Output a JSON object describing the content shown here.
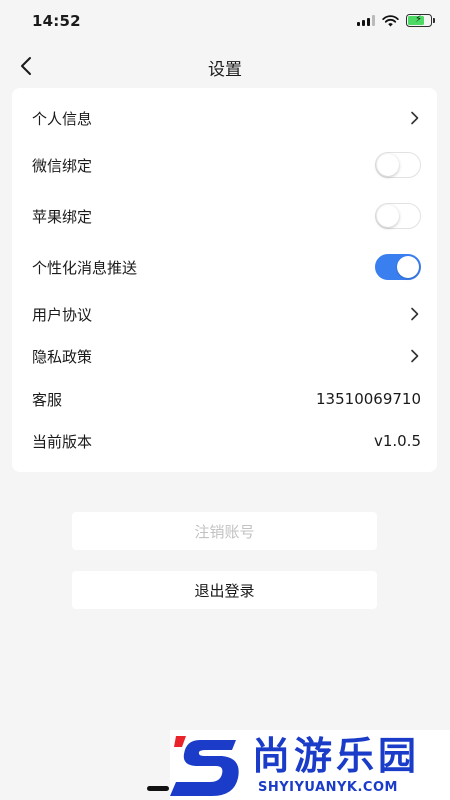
{
  "status_bar": {
    "time": "14:52",
    "battery_level": 0.75,
    "icons": [
      "signal-icon",
      "wifi-icon",
      "battery-charging-icon"
    ]
  },
  "nav": {
    "title": "设置",
    "back_icon": "chevron-left-icon"
  },
  "settings": {
    "personal_info": {
      "label": "个人信息",
      "icon": "chevron-right-icon"
    },
    "wechat_bind": {
      "label": "微信绑定",
      "toggle_on": false
    },
    "apple_bind": {
      "label": "苹果绑定",
      "toggle_on": false
    },
    "personalized_push": {
      "label": "个性化消息推送",
      "toggle_on": true
    },
    "user_agreement": {
      "label": "用户协议",
      "icon": "chevron-right-icon"
    },
    "privacy_policy": {
      "label": "隐私政策",
      "icon": "chevron-right-icon"
    },
    "customer_service": {
      "label": "客服",
      "value": "13510069710"
    },
    "current_version": {
      "label": "当前版本",
      "value": "v1.0.5"
    }
  },
  "buttons": {
    "cancel_account": "注销账号",
    "logout": "退出登录"
  },
  "colors": {
    "accent": "#3a7ff0",
    "background": "#f5f5f5",
    "card": "#ffffff",
    "disabled_text": "#c2c2c2",
    "watermark": "#1a3cc8"
  },
  "watermark": {
    "name": "尚游乐园",
    "url": "SHYIYUANYK.COM"
  }
}
